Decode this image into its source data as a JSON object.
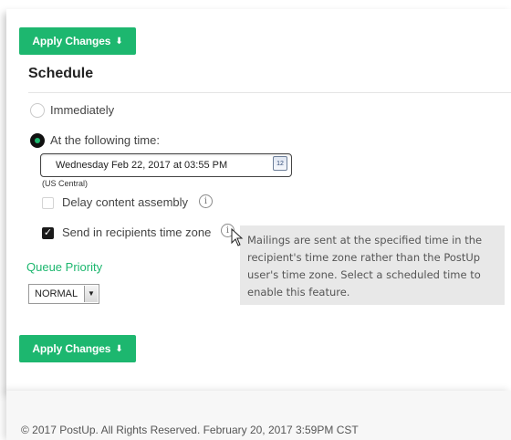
{
  "apply_top": {
    "label": "Apply Changes",
    "arrow": "⬇"
  },
  "schedule": {
    "title": "Schedule",
    "immediately_label": "Immediately",
    "following_label": "At the following time:",
    "datetime_value": "Wednesday Feb 22, 2017 at 03:55 PM",
    "calendar_icon_text": "12",
    "timezone": "(US Central)",
    "delay_label": "Delay content assembly",
    "delay_checked": false,
    "recipients_tz_label": "Send in recipients time zone",
    "recipients_tz_checked": true,
    "selected_option": "at_following_time"
  },
  "tooltip": {
    "lines": [
      "Mailings are sent at the specified time in the",
      "recipient's time zone rather than the PostUp",
      "user's time zone. Select a scheduled time to",
      "enable this feature."
    ]
  },
  "queue": {
    "label": "Queue Priority",
    "selected": "NORMAL"
  },
  "apply_bottom": {
    "label": "Apply Changes",
    "arrow": "⬇"
  },
  "footer": {
    "copyright": "© 2017 PostUp. All Rights Reserved. February 20, 2017 3:59PM CST"
  },
  "colors": {
    "accent": "#1db76f",
    "tooltip_bg": "#e8e8e8"
  },
  "icons": [
    "calendar-icon",
    "info-icon",
    "pointer-cursor-icon",
    "down-arrow-icon",
    "checkmark-icon"
  ]
}
